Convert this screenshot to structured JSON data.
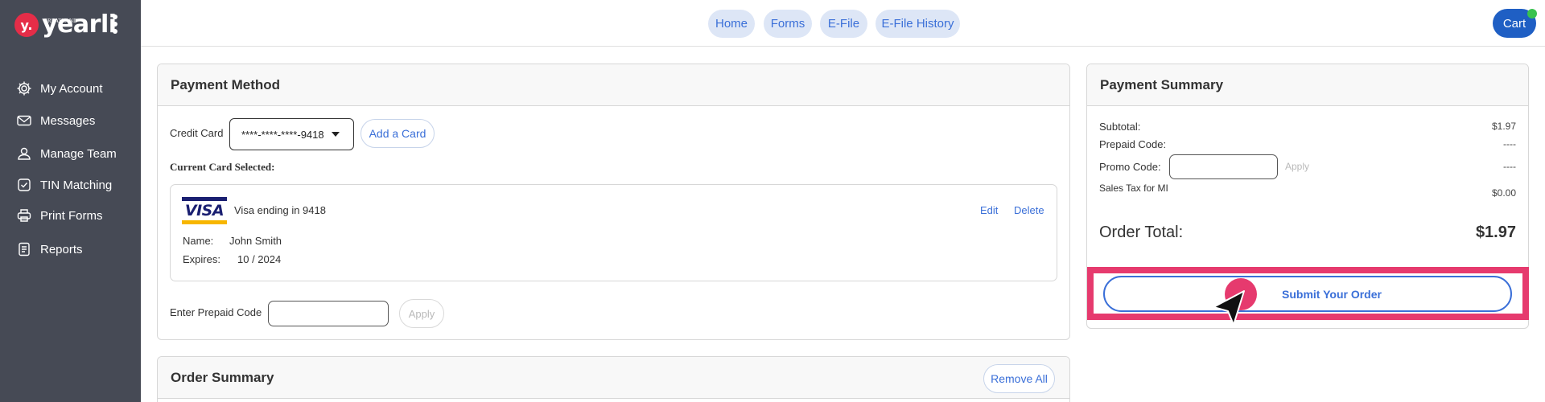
{
  "brand": {
    "badge": "y.",
    "name": "yearli",
    "sup": "GREATLAND"
  },
  "sidebar": {
    "items": [
      {
        "label": "My Account",
        "icon": "gear-icon"
      },
      {
        "label": "Messages",
        "icon": "envelope-icon"
      },
      {
        "label": "Manage Team",
        "icon": "user-icon"
      },
      {
        "label": "TIN Matching",
        "icon": "check-square-icon"
      },
      {
        "label": "Print Forms",
        "icon": "printer-icon"
      },
      {
        "label": "Reports",
        "icon": "document-icon"
      }
    ]
  },
  "topnav": {
    "items": [
      "Home",
      "Forms",
      "E-File",
      "E-File History"
    ],
    "cart": "Cart"
  },
  "payment_method": {
    "title": "Payment Method",
    "credit_card_label": "Credit Card",
    "selected_card": "****-****-****-9418",
    "add_card": "Add a Card",
    "current_label": "Current Card Selected:",
    "card": {
      "brand": "VISA",
      "ending": "Visa ending in 9418",
      "name_label": "Name:",
      "name": "John Smith",
      "expires_label": "Expires:",
      "expires": "10 / 2024",
      "edit": "Edit",
      "delete": "Delete"
    },
    "prepaid_label": "Enter Prepaid Code",
    "apply": "Apply"
  },
  "order_summary": {
    "title": "Order Summary",
    "remove_all": "Remove All"
  },
  "payment_summary": {
    "title": "Payment Summary",
    "subtotal_label": "Subtotal:",
    "subtotal": "$1.97",
    "prepaid_label": "Prepaid Code:",
    "prepaid": "----",
    "promo_label": "Promo Code:",
    "promo_apply": "Apply",
    "promo": "----",
    "tax_label": "Sales Tax for MI",
    "tax": "$0.00",
    "total_label": "Order Total:",
    "total": "$1.97",
    "submit": "Submit Your Order"
  },
  "colors": {
    "accent": "#3a6fd8",
    "highlight": "#e63a6e",
    "sidebar": "#464a55",
    "cart": "#1f5fc4"
  }
}
